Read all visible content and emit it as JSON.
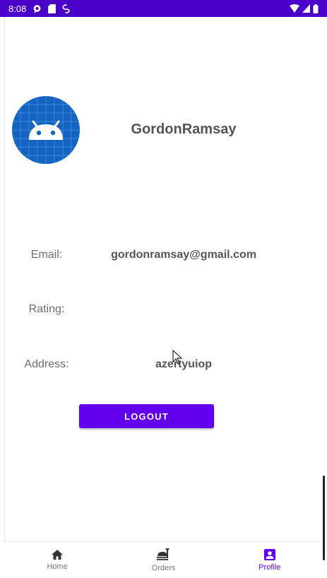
{
  "status_bar": {
    "time": "8:08",
    "background_color": "#4a00c8",
    "left_icons": [
      "chat-bubble-icon",
      "sd-card-icon",
      "sync-icon"
    ],
    "right_icons": [
      "wifi-icon",
      "signal-icon",
      "battery-icon"
    ]
  },
  "profile": {
    "username": "GordonRamsay",
    "avatar_icon": "android-robot-icon"
  },
  "fields": {
    "email_label": "Email:",
    "email_value": "gordonramsay@gmail.com",
    "rating_label": "Rating:",
    "rating_value": "",
    "address_label": "Address:",
    "address_value": "azertyuiop"
  },
  "actions": {
    "logout_label": "LOGOUT",
    "accent_color": "#6200ee"
  },
  "bottom_nav": {
    "items": [
      {
        "label": "Home",
        "icon": "home-icon",
        "active": false
      },
      {
        "label": "Orders",
        "icon": "food-tray-icon",
        "active": false
      },
      {
        "label": "Profile",
        "icon": "account-box-icon",
        "active": true
      }
    ]
  }
}
